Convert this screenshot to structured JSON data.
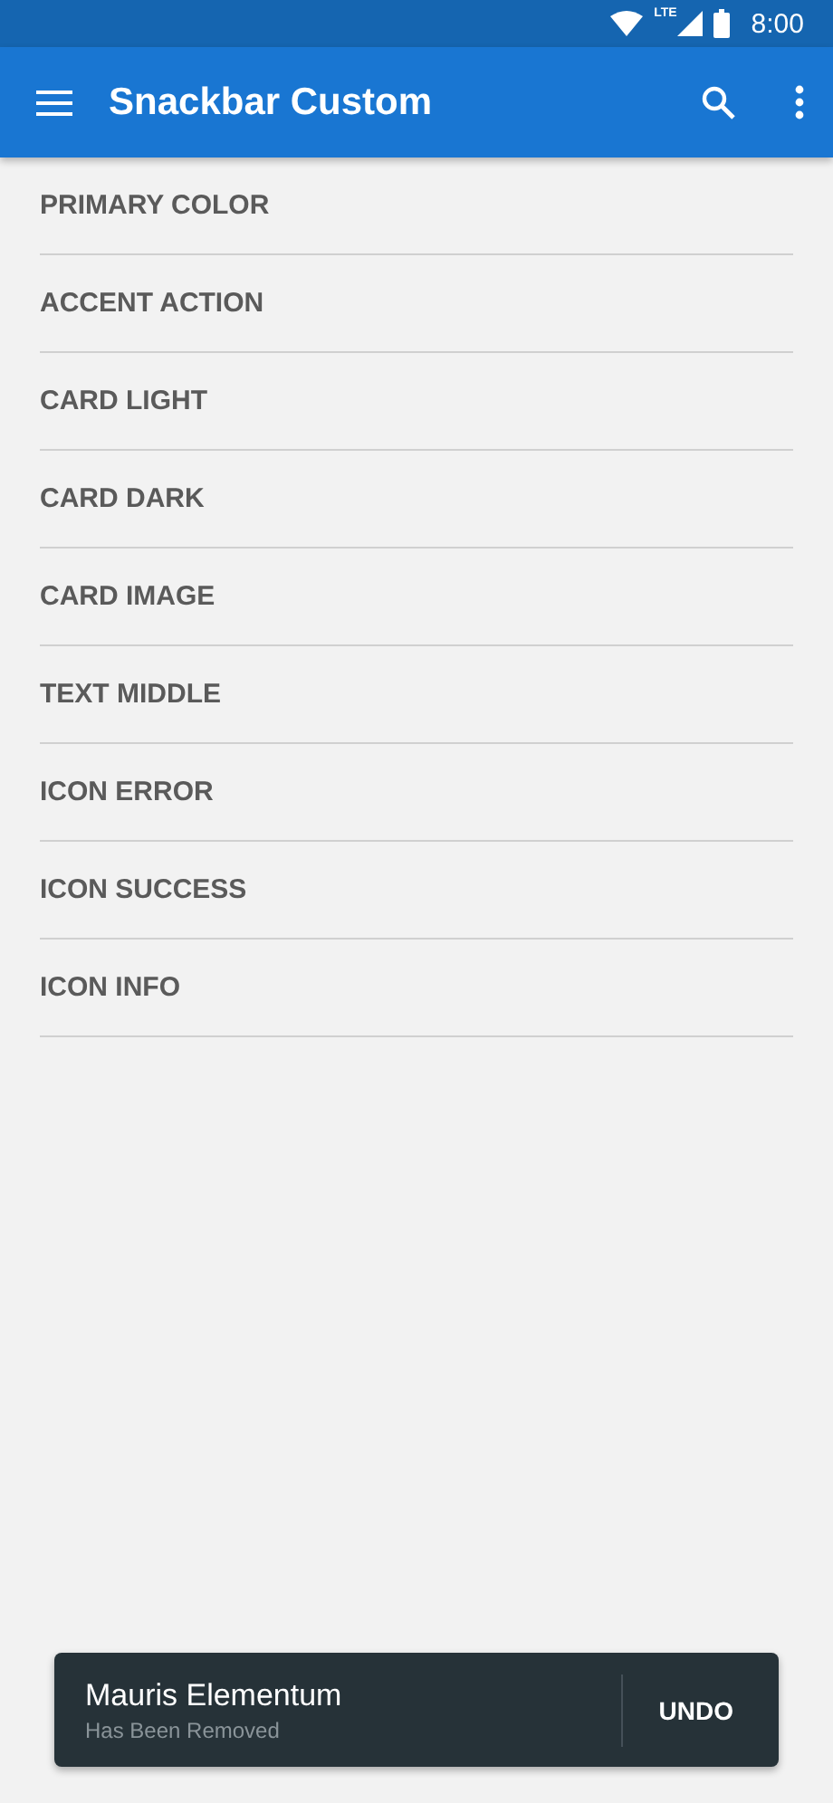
{
  "status_bar": {
    "time": "8:00",
    "network": "LTE"
  },
  "app_bar": {
    "title": "Snackbar Custom"
  },
  "items": [
    {
      "label": "PRIMARY COLOR"
    },
    {
      "label": "ACCENT ACTION"
    },
    {
      "label": "CARD LIGHT"
    },
    {
      "label": "CARD DARK"
    },
    {
      "label": "CARD IMAGE"
    },
    {
      "label": "TEXT MIDDLE"
    },
    {
      "label": "ICON ERROR"
    },
    {
      "label": "ICON SUCCESS"
    },
    {
      "label": "ICON INFO"
    }
  ],
  "snackbar": {
    "title": "Mauris Elementum",
    "subtitle": "Has Been Removed",
    "action": "UNDO"
  }
}
